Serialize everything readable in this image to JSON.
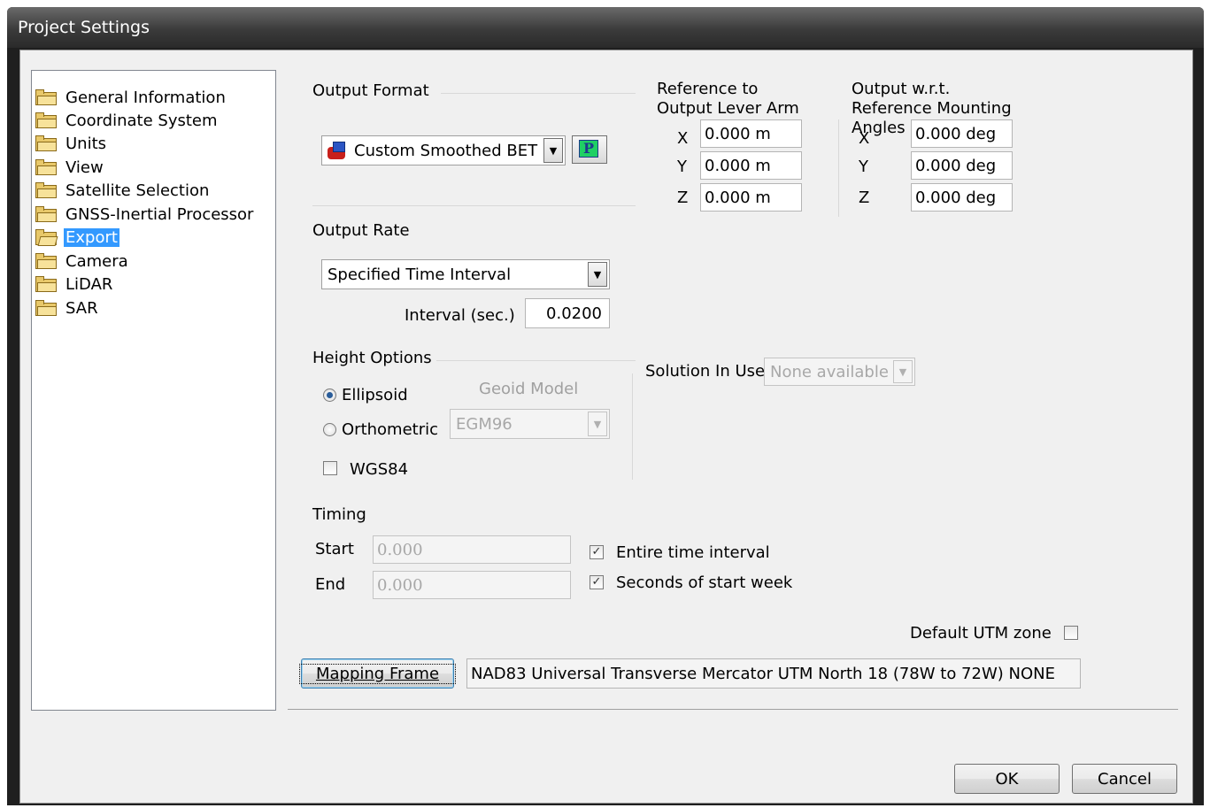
{
  "window": {
    "title": "Project Settings"
  },
  "tree": {
    "items": [
      {
        "label": "General Information",
        "icon": "folder-icon"
      },
      {
        "label": "Coordinate System",
        "icon": "folder-icon"
      },
      {
        "label": "Units",
        "icon": "folder-icon"
      },
      {
        "label": "View",
        "icon": "folder-icon"
      },
      {
        "label": "Satellite Selection",
        "icon": "folder-icon"
      },
      {
        "label": "GNSS-Inertial Processor",
        "icon": "folder-icon"
      },
      {
        "label": "Export",
        "icon": "folder-open-icon",
        "selected": true
      },
      {
        "label": "Camera",
        "icon": "folder-icon"
      },
      {
        "label": "LiDAR",
        "icon": "folder-icon"
      },
      {
        "label": "SAR",
        "icon": "folder-icon"
      }
    ]
  },
  "output_format": {
    "heading": "Output Format",
    "selected": "Custom Smoothed BET",
    "selected_icon": "export-format-icon",
    "edit_icon": "p-edit-icon"
  },
  "lever_arm": {
    "heading": "Reference to Output Lever Arm",
    "x_label": "X",
    "x_value": "0.000 m",
    "y_label": "Y",
    "y_value": "0.000 m",
    "z_label": "Z",
    "z_value": "0.000 m"
  },
  "mounting": {
    "heading": "Output w.r.t. Reference Mounting Angles",
    "x_label": "X",
    "x_value": "0.000 deg",
    "y_label": "Y",
    "y_value": "0.000 deg",
    "z_label": "Z",
    "z_value": "0.000 deg"
  },
  "output_rate": {
    "heading": "Output Rate",
    "selected": "Specified Time Interval",
    "interval_label": "Interval (sec.)",
    "interval_value": "0.0200"
  },
  "height_options": {
    "heading": "Height Options",
    "ellipsoid_label": "Ellipsoid",
    "ellipsoid_checked": true,
    "orthometric_label": "Orthometric",
    "orthometric_checked": false,
    "geoid_label": "Geoid Model",
    "geoid_value": "EGM96",
    "wgs84_label": "WGS84",
    "wgs84_checked": false
  },
  "solution": {
    "label": "Solution In Use",
    "value": "None available"
  },
  "timing": {
    "heading": "Timing",
    "start_label": "Start",
    "start_value": "0.000",
    "end_label": "End",
    "end_value": "0.000",
    "entire_label": "Entire time interval",
    "entire_checked": true,
    "seconds_label": "Seconds of start week",
    "seconds_checked": true
  },
  "utm": {
    "label": "Default UTM zone",
    "checked": false
  },
  "mapping": {
    "button_label": "Mapping Frame",
    "value": "NAD83 Universal Transverse Mercator UTM North 18 (78W to 72W) NONE"
  },
  "footer": {
    "ok_label": "OK",
    "cancel_label": "Cancel"
  }
}
